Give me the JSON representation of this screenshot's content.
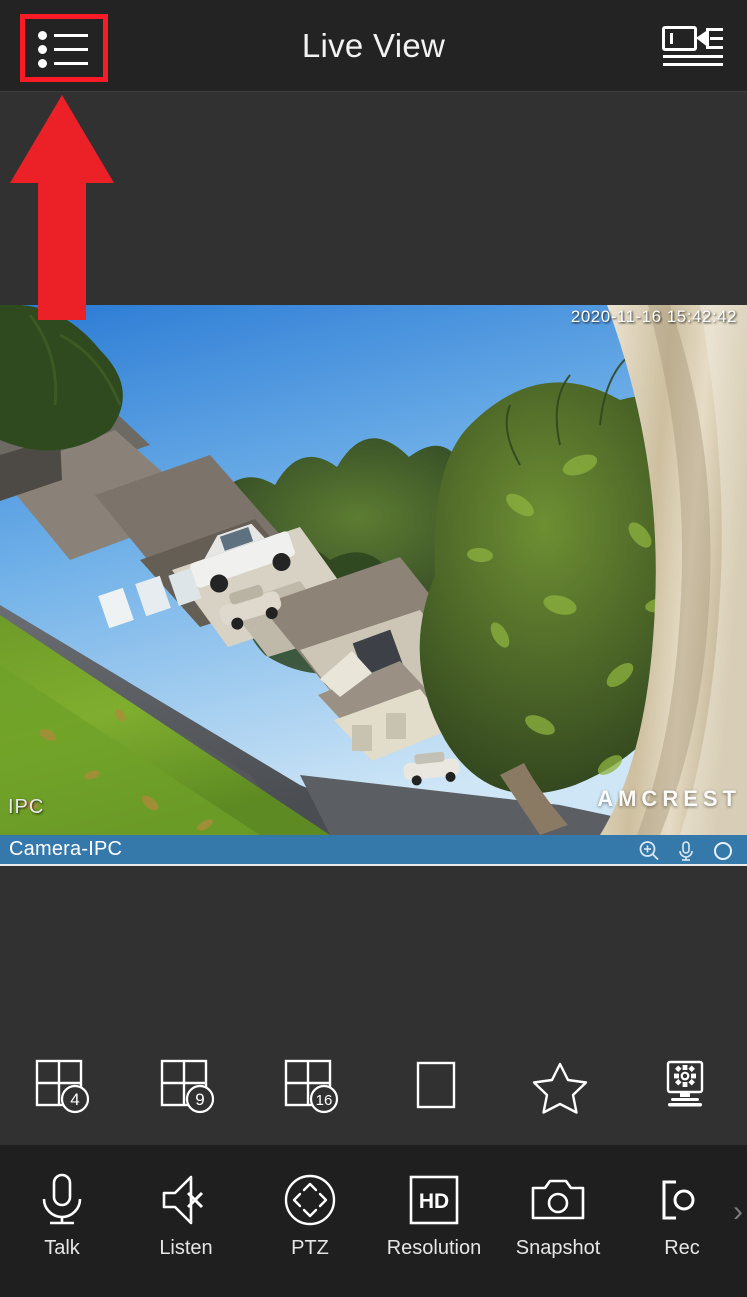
{
  "header": {
    "title": "Live View",
    "menu_button_name": "menu",
    "menu_icon": "list-menu-icon",
    "camera_list_icon": "camera-list-icon"
  },
  "annotation": {
    "type": "arrow",
    "direction": "up",
    "color": "#fa1b26",
    "points_at": "menu-button",
    "highlight_color": "#fa1b26"
  },
  "video": {
    "timestamp": "2020-11-16 15:42:42",
    "channel_overlay": "IPC",
    "brand_watermark": "AMCREST",
    "scene": "outdoor fisheye view of suburban street, lawn, houses, trees, white pickup truck",
    "sky_color": "#4d97de",
    "grass_color": "#5f8f28",
    "road_color": "#55585c",
    "wall_color": "#d9cfb8"
  },
  "channel_bar": {
    "name": "Camera-IPC",
    "background": "#3579ab",
    "icons": [
      {
        "name": "zoom-in-icon",
        "label": "Digital Zoom"
      },
      {
        "name": "microphone-icon",
        "label": "Talk"
      },
      {
        "name": "record-circle-icon",
        "label": "Record"
      }
    ]
  },
  "layout_bar": {
    "items": [
      {
        "name": "layout-4-button",
        "icon": "grid-icon",
        "badge": "4"
      },
      {
        "name": "layout-9-button",
        "icon": "grid-icon",
        "badge": "9"
      },
      {
        "name": "layout-16-button",
        "icon": "grid-icon",
        "badge": "16"
      },
      {
        "name": "layout-1-button",
        "icon": "single-pane-icon",
        "badge": ""
      },
      {
        "name": "favorites-button",
        "icon": "star-icon",
        "badge": ""
      },
      {
        "name": "device-settings-button",
        "icon": "monitor-gear-icon",
        "badge": ""
      }
    ]
  },
  "toolbar": {
    "items": [
      {
        "name": "talk-button",
        "label": "Talk",
        "icon": "microphone-icon"
      },
      {
        "name": "listen-button",
        "label": "Listen",
        "icon": "speaker-muted-icon"
      },
      {
        "name": "ptz-button",
        "label": "PTZ",
        "icon": "ptz-dpad-icon"
      },
      {
        "name": "resolution-button",
        "label": "Resolution",
        "icon": "hd-icon"
      },
      {
        "name": "snapshot-button",
        "label": "Snapshot",
        "icon": "camera-icon"
      },
      {
        "name": "record-button",
        "label": "Rec",
        "icon": "record-icon"
      }
    ],
    "more_indicator": "›"
  }
}
